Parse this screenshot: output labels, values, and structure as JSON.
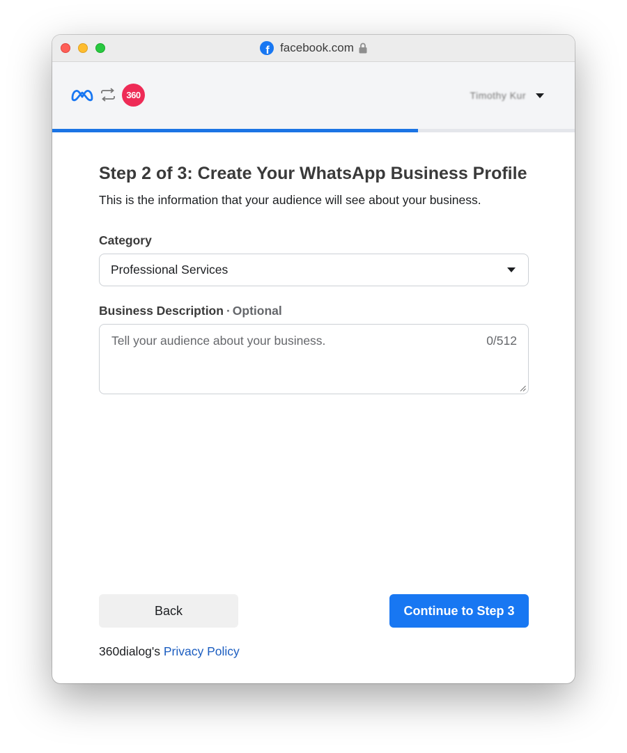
{
  "browser": {
    "url": "facebook.com"
  },
  "header": {
    "logo_360": "360",
    "account_name": "Timothy Kur"
  },
  "progress": {
    "fraction": 0.7
  },
  "form": {
    "title": "Step 2 of 3: Create Your WhatsApp Business Profile",
    "subtitle": "This is the information that your audience will see about your business.",
    "category_label": "Category",
    "category_value": "Professional Services",
    "description_label": "Business Description",
    "description_separator": "·",
    "description_optional": "Optional",
    "description_placeholder": "Tell your audience about your business.",
    "description_counter": "0/512"
  },
  "footer": {
    "back_label": "Back",
    "continue_label": "Continue to Step 3",
    "privacy_prefix": "360dialog's",
    "privacy_link": "Privacy Policy"
  },
  "colors": {
    "accent": "#1877f2",
    "progress": "#1b74e4",
    "brand_360": "#ee2b56",
    "link": "#1b5dc0"
  }
}
